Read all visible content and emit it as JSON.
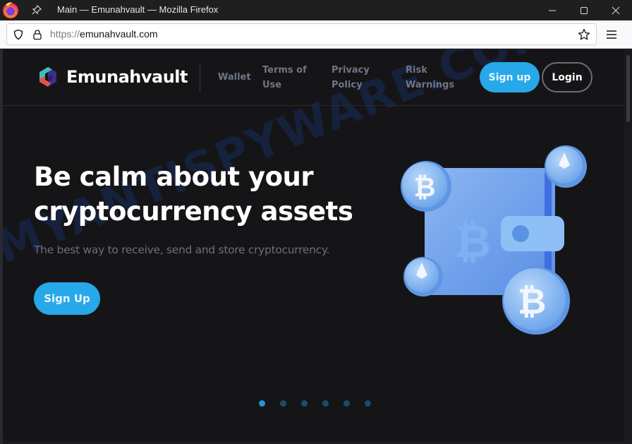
{
  "window": {
    "title": "Main — Emunahvault — Mozilla Firefox",
    "controls": {
      "minimize": "minimize",
      "maximize": "maximize",
      "close": "close"
    }
  },
  "browser": {
    "url_protocol": "https://",
    "url_host": "emunahvault.com",
    "icons": [
      "firefox-logo",
      "pin-icon",
      "shield-icon",
      "lock-icon",
      "star-icon",
      "hamburger-menu-icon"
    ]
  },
  "site": {
    "brand": "Emunahvault",
    "nav": [
      {
        "label": "Wallet"
      },
      {
        "label": "Terms of Use"
      },
      {
        "label": "Privacy Policy"
      },
      {
        "label": "Risk Warnings"
      }
    ],
    "signup_label": "Sign up",
    "login_label": "Login"
  },
  "hero": {
    "title": "Be calm about your cryptocurrency assets",
    "subtitle": "The best way to receive, send and store cryptocurrency.",
    "cta_label": "Sign Up",
    "illustration": "crypto-wallet-with-bitcoin-and-ethereum-coins"
  },
  "carousel": {
    "total": 6,
    "active_index": 0
  },
  "watermark": "MYANTISPYWARE.COM",
  "colors": {
    "accent": "#27a8e9",
    "page_bg": "#151517",
    "nav_text": "#6f7587",
    "dot_active": "#2a93cf",
    "dot_inactive": "#1f4a6a"
  }
}
